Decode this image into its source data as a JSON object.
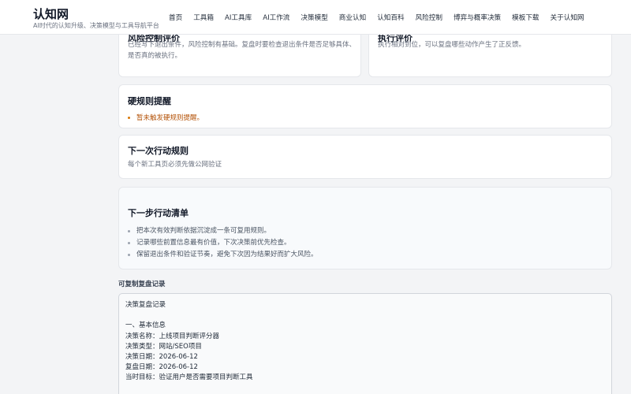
{
  "brand": {
    "title": "认知网",
    "subtitle": "AI时代的认知升级、决策模型与工具导航平台"
  },
  "nav": [
    "首页",
    "工具箱",
    "AI工具库",
    "AI工作流",
    "决策模型",
    "商业认知",
    "认知百科",
    "风险控制",
    "博弈与概率决策",
    "模板下载",
    "关于认知网"
  ],
  "risk_card": {
    "title": "风险控制评价",
    "text": "已经写下退出条件，风险控制有基础。复盘时要检查退出条件是否足够具体、是否真的被执行。"
  },
  "exec_card": {
    "title": "执行评价",
    "text": "执行相对到位，可以复盘哪些动作产生了正反馈。"
  },
  "hard_rule": {
    "title": "硬规则提醒",
    "alert": "暂未触发硬规则提醒。"
  },
  "next_rule": {
    "title": "下一次行动规则",
    "text": "每个新工具页必须先做公网验证"
  },
  "next_steps": {
    "title": "下一步行动清单",
    "items": [
      "把本次有效判断依据沉淀成一条可复用规则。",
      "记录哪些前置信息最有价值，下次决策前优先检查。",
      "保留退出条件和验证节奏，避免下次因为结果好而扩大风险。"
    ]
  },
  "copy_section": {
    "label": "可复制复盘记录",
    "lines": [
      "决策复盘记录",
      "",
      "一、基本信息",
      "决策名称：上线项目判断评分器",
      "决策类型：网站/SEO项目",
      "决策日期：2026-06-12",
      "复盘日期：2026-06-12",
      "当时目标：验证用户是否需要项目判断工具"
    ]
  }
}
